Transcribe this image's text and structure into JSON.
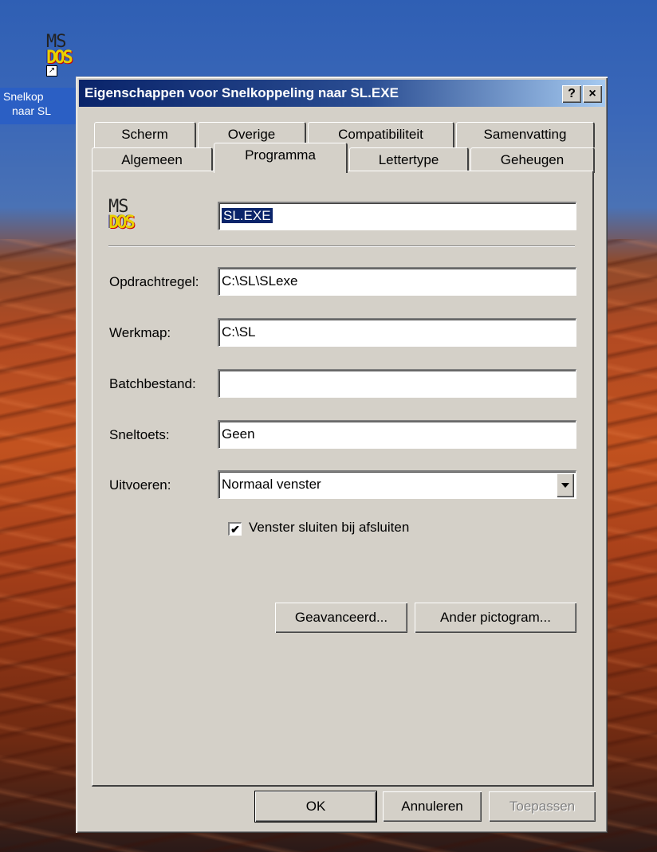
{
  "desktop": {
    "icon_label_line1": "Snelkop",
    "icon_label_line2": "naar SL",
    "icon_logo_top": "MS",
    "icon_logo_bottom": "DOS"
  },
  "dialog": {
    "title": "Eigenschappen voor Snelkoppeling naar SL.EXE",
    "help_button": "?",
    "close_button": "×",
    "tabs_back": [
      "Scherm",
      "Overige",
      "Compatibiliteit",
      "Samenvatting"
    ],
    "tabs_front": [
      "Algemeen",
      "Programma",
      "Lettertype",
      "Geheugen"
    ],
    "active_tab": "Programma",
    "program": {
      "logo_top": "MS",
      "logo_bottom": "DOS",
      "name_value": "SL.EXE",
      "fields": [
        {
          "label": "Opdrachtregel:",
          "value": "C:\\SL\\SLexe"
        },
        {
          "label": "Werkmap:",
          "value": "C:\\SL"
        },
        {
          "label": "Batchbestand:",
          "value": ""
        },
        {
          "label": "Sneltoets:",
          "value": "Geen"
        }
      ],
      "run_label": "Uitvoeren:",
      "run_value": "Normaal venster",
      "close_on_exit_label": "Venster sluiten bij afsluiten",
      "close_on_exit_checked": true,
      "advanced_button": "Geavanceerd...",
      "change_icon_button": "Ander pictogram..."
    },
    "buttons": {
      "ok": "OK",
      "cancel": "Annuleren",
      "apply": "Toepassen"
    }
  }
}
